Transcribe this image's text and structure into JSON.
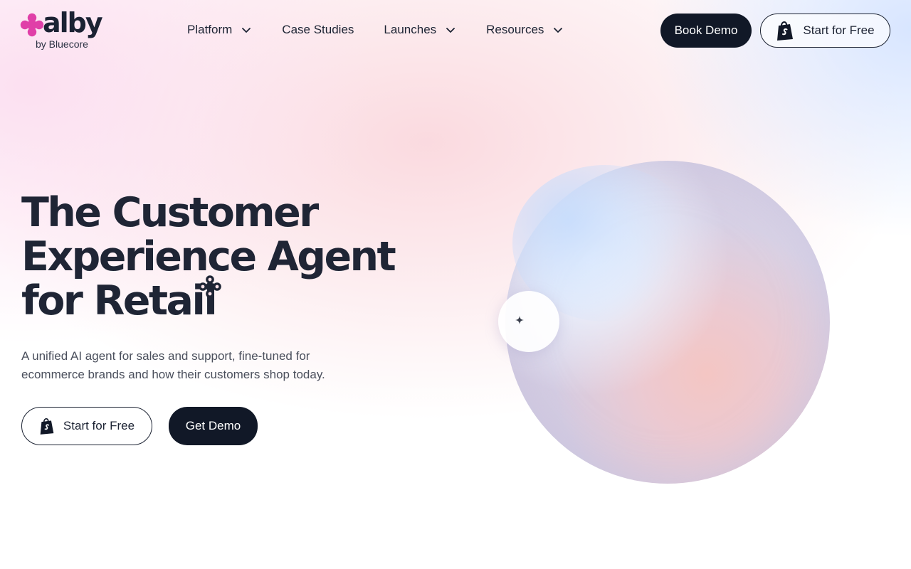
{
  "brand": {
    "logo_word": "alby",
    "logo_sub": "by Bluecore",
    "accent": "#e03fa8",
    "dark": "#111827"
  },
  "nav": {
    "items": [
      {
        "label": "Platform",
        "has_dropdown": true
      },
      {
        "label": "Case Studies",
        "has_dropdown": false
      },
      {
        "label": "Launches",
        "has_dropdown": true
      },
      {
        "label": "Resources",
        "has_dropdown": true
      }
    ],
    "book_demo": "Book Demo",
    "start_free": "Start for Free"
  },
  "hero": {
    "title_lines": [
      "The Customer",
      "Experience Agent",
      "for Retail"
    ],
    "subtitle_lines": [
      "A unified AI agent for sales and support, fine-tuned for",
      "ecommerce brands and how their customers shop today."
    ],
    "cta_start": "Start for Free",
    "cta_demo": "Get Demo"
  },
  "icons": {
    "logo": "alby-logo-icon",
    "dropdown": "chevron-down-icon",
    "shopify": "shopify-bag-icon",
    "sparkle": "sparkle-icon"
  }
}
